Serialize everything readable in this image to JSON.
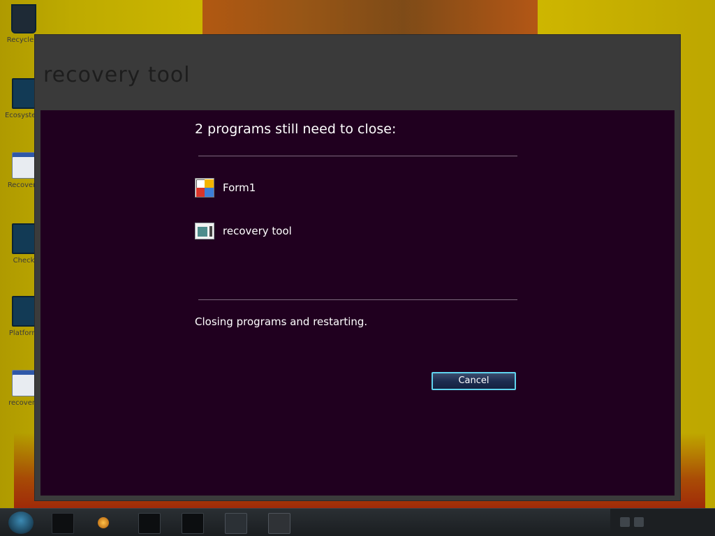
{
  "desktop": {
    "icons": [
      {
        "name": "recycle-bin",
        "caption": "Recycle B"
      },
      {
        "name": "app",
        "caption": "Ecosystem"
      },
      {
        "name": "window",
        "caption": "Recovery"
      },
      {
        "name": "app",
        "caption": "Check"
      },
      {
        "name": "app",
        "caption": "Platform"
      },
      {
        "name": "window",
        "caption": "recovery"
      }
    ]
  },
  "shell": {
    "title": "recovery tool"
  },
  "dialog": {
    "heading": "2 programs still need to close:",
    "programs": [
      {
        "label": "Form1",
        "icon": "form1-app-icon"
      },
      {
        "label": "recovery tool",
        "icon": "recovery-tool-app-icon"
      }
    ],
    "status": "Closing programs and restarting.",
    "cancel_label": "Cancel"
  },
  "colors": {
    "panel_bg": "#20001f",
    "shell_bg": "#3a3a3a",
    "button_border": "#5fd4ee",
    "text": "#ffffff"
  }
}
